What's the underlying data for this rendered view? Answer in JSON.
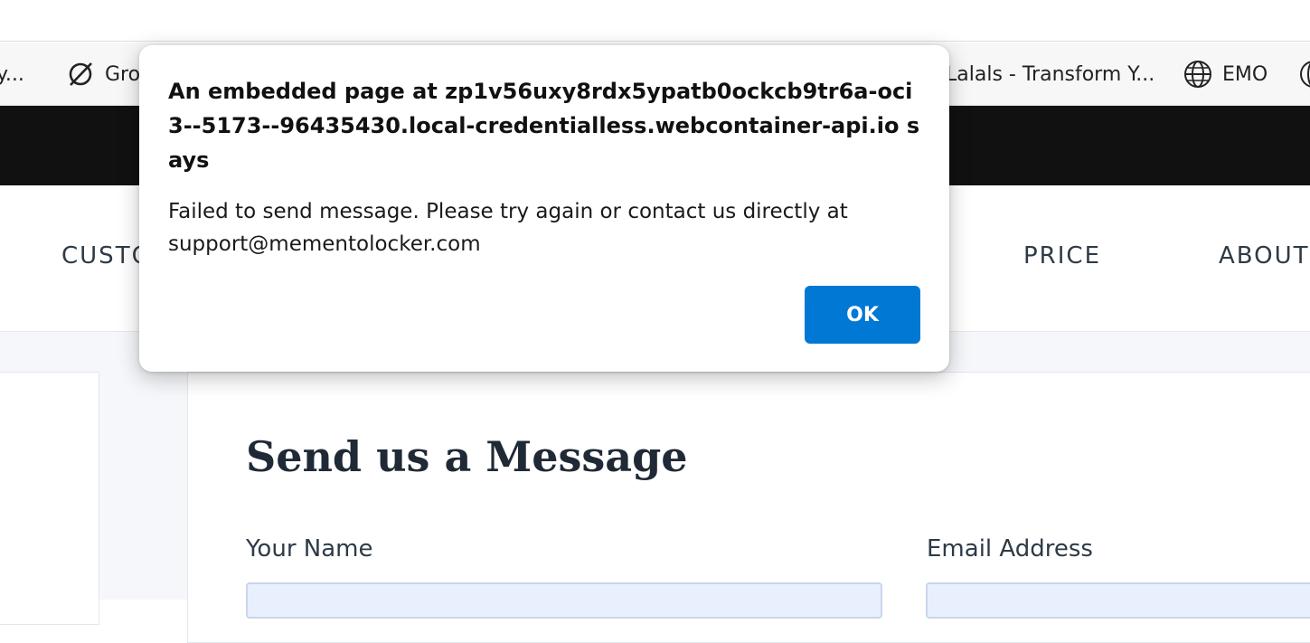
{
  "bookmarks": [
    {
      "label": "y...",
      "icon": "none"
    },
    {
      "label": "Gro",
      "icon": "grok-icon"
    },
    {
      "label": "Lalals - Transform Y...",
      "icon": "none"
    },
    {
      "label": "EMO",
      "icon": "globe-icon"
    }
  ],
  "nav": {
    "items": [
      "CUSTO",
      "PRICE",
      "ABOUT"
    ]
  },
  "form": {
    "title": "Send us a Message",
    "name_label": "Your Name",
    "email_label": "Email Address",
    "fragment": "?"
  },
  "dialog": {
    "title": "An embedded page at zp1v56uxy8rdx5ypatb0ockcb9tr6a-oci3--5173--96435430.local-credentialless.webcontainer-api.io says",
    "message": "Failed to send message. Please try again or contact us directly at support@mementolocker.com",
    "ok_label": "OK"
  },
  "colors": {
    "ok_button": "#0078d4",
    "site_topbar": "#111111",
    "input_fill": "#e8f0fe"
  }
}
